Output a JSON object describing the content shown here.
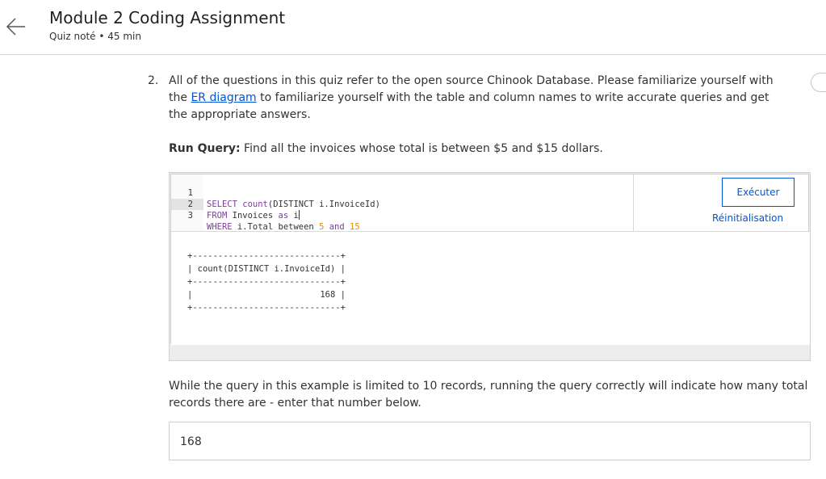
{
  "header": {
    "title": "Module 2 Coding Assignment",
    "subtitle": "Quiz noté • 45 min",
    "back_icon": "arrow-left-icon"
  },
  "question": {
    "number": "2.",
    "text_before_link": "All of the questions in this quiz refer to the open source Chinook Database. Please familiarize yourself with the ",
    "link_text": "ER diagram",
    "text_after_link": " to familiarize yourself with the table and column names to write accurate queries and get the appropriate answers.",
    "run_query_label": "Run Query:",
    "run_query_text": " Find all the invoices whose total is between $5 and $15 dollars."
  },
  "editor": {
    "lines": [
      {
        "number": "1",
        "text": "SELECT count(DISTINCT i.InvoiceId)"
      },
      {
        "number": "2",
        "text": "FROM Invoices as i"
      },
      {
        "number": "3",
        "text": "WHERE i.Total between 5 and 15"
      }
    ],
    "active_line": 2,
    "run_button_label": "Exécuter",
    "reset_label": "Réinitialisation"
  },
  "output": {
    "text": "+-----------------------------+\n| count(DISTINCT i.InvoiceId) |\n+-----------------------------+\n|                         168 |\n+-----------------------------+"
  },
  "after_text": "While the query in this example is limited to 10 records, running the query correctly will indicate how many total records there are - enter that number below.",
  "answer": {
    "value": "168"
  },
  "colors": {
    "accent": "#0056d2",
    "keyword": "#7a3e9d",
    "number": "#e08e0b",
    "text": "#333333"
  }
}
